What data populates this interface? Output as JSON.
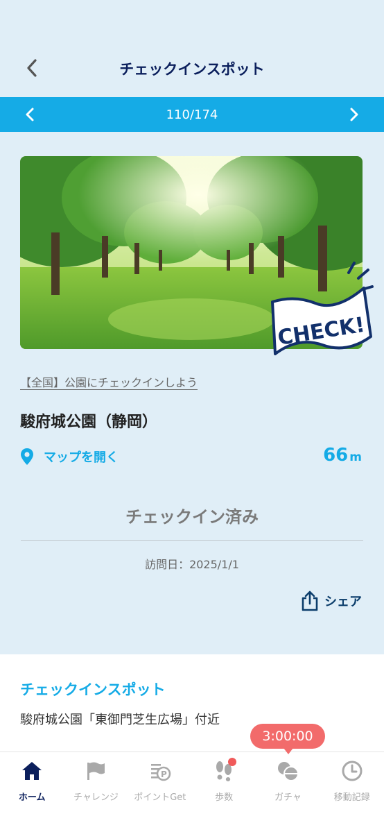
{
  "header": {
    "title": "チェックインスポット",
    "back_icon": "chevron-left-icon"
  },
  "pager": {
    "label": "110/174",
    "prev_icon": "chevron-left-icon",
    "next_icon": "chevron-right-icon"
  },
  "spot": {
    "badge_text": "CHECK!",
    "category": "【全国】公園にチェックインしよう",
    "name": "駿府城公園（静岡）",
    "map_label": "マップを開く",
    "map_icon": "location-pin-icon",
    "distance_value": "66",
    "distance_unit": "m",
    "status": "チェックイン済み",
    "visit_date": "訪問日：2025/1/1",
    "share_label": "シェア",
    "share_icon": "share-icon"
  },
  "info": {
    "title": "チェックインスポット",
    "text": "駿府城公園「東御門芝生広場」付近"
  },
  "tabbar": {
    "timer": "3:00:00",
    "items": [
      {
        "label": "ホーム",
        "icon": "home-icon",
        "active": true
      },
      {
        "label": "チャレンジ",
        "icon": "flag-icon",
        "active": false
      },
      {
        "label": "ポイントGet",
        "icon": "points-icon",
        "active": false
      },
      {
        "label": "歩数",
        "icon": "footprints-icon",
        "active": false
      },
      {
        "label": "ガチャ",
        "icon": "gacha-icon",
        "active": false
      },
      {
        "label": "移動記録",
        "icon": "clock-icon",
        "active": false
      }
    ]
  },
  "colors": {
    "accent": "#15abe6",
    "navy": "#0b1f5c",
    "background": "#e0eef7",
    "timer": "#f26b6b"
  }
}
